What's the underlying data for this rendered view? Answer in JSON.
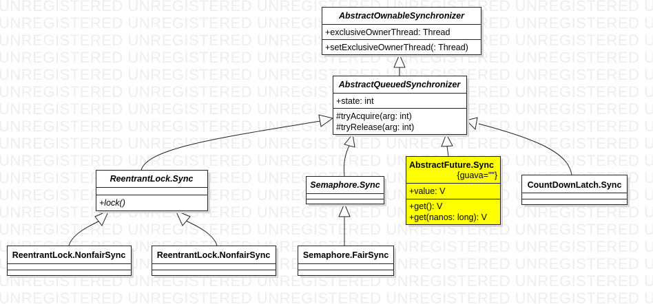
{
  "watermark": "UNREGISTERED",
  "colors": {
    "highlight": "#ffff00",
    "border": "#222222"
  },
  "classes": {
    "aos": {
      "name": "AbstractOwnableSynchronizer",
      "attrs": [
        "+exclusiveOwnerThread: Thread"
      ],
      "ops": [
        "+setExclusiveOwnerThread(: Thread)"
      ]
    },
    "aqs": {
      "name": "AbstractQueuedSynchronizer",
      "attrs": [
        "+state: int"
      ],
      "ops": [
        "#tryAcquire(arg: int)",
        "#tryRelease(arg: int)"
      ]
    },
    "rlsync": {
      "name": "ReentrantLock.Sync",
      "ops": [
        "+lock()"
      ]
    },
    "semsync": {
      "name": "Semaphore.Sync"
    },
    "afsync": {
      "name": "AbstractFuture.Sync",
      "tag": "{guava=\"\"}",
      "attrs": [
        "+value: V"
      ],
      "ops": [
        "+get(): V",
        "+get(nanos: long): V"
      ]
    },
    "cdlsync": {
      "name": "CountDownLatch.Sync"
    },
    "nonfair1": {
      "name": "ReentrantLock.NonfairSync"
    },
    "nonfair2": {
      "name": "ReentrantLock.NonfairSync"
    },
    "semfair": {
      "name": "Semaphore.FairSync"
    }
  }
}
